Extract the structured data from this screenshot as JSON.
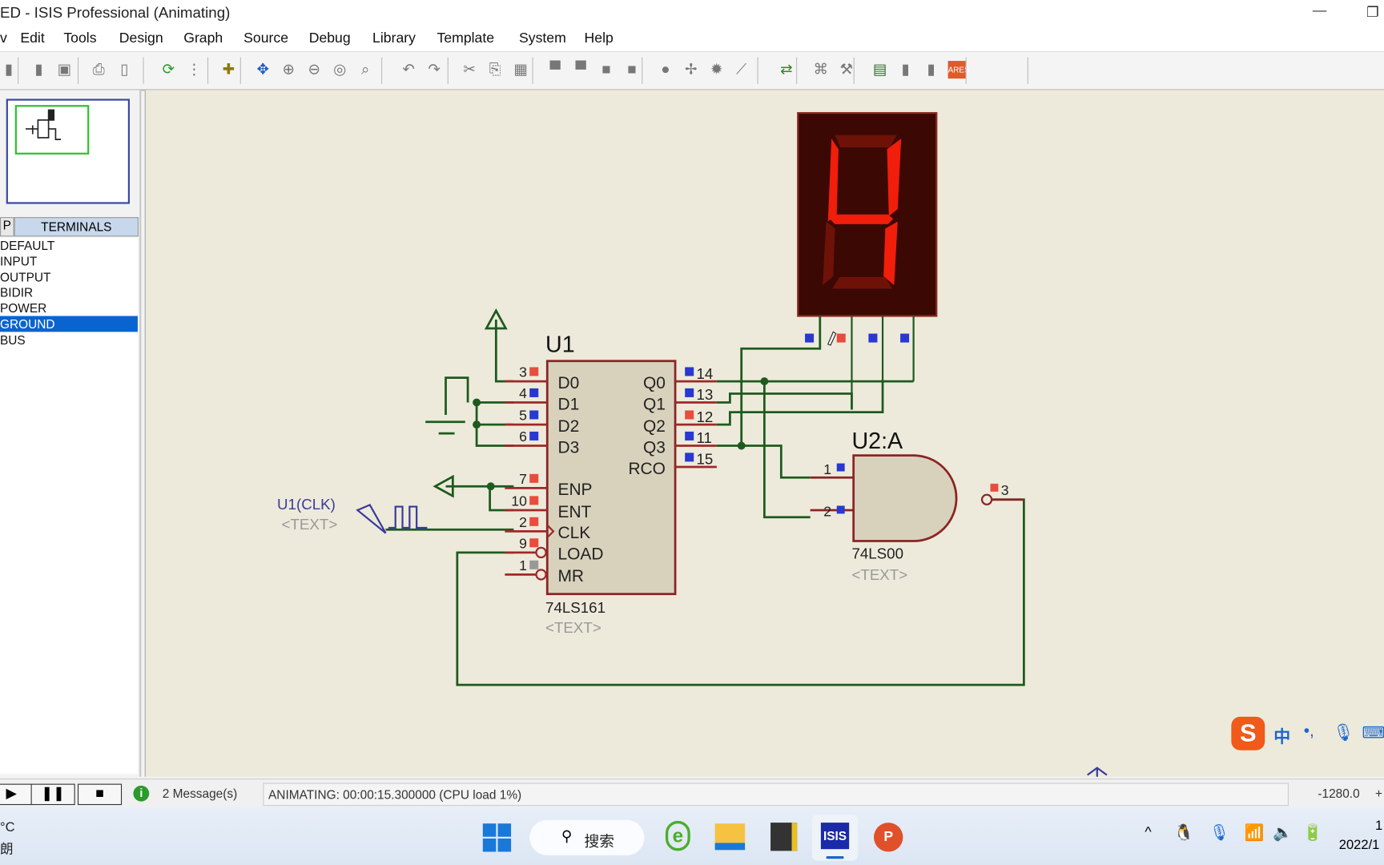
{
  "window": {
    "title": "ED - ISIS Professional (Animating)"
  },
  "menu": [
    "v",
    "Edit",
    "Tools",
    "Design",
    "Graph",
    "Source",
    "Debug",
    "Library",
    "Template",
    "System",
    "Help"
  ],
  "toolbar": {
    "icons": [
      "new-icon",
      "copy-sheet-icon",
      "import-icon",
      "print-icon",
      "page-icon",
      "refresh-icon",
      "grid-icon",
      "origin-icon",
      "pan-icon",
      "zoom-in-icon",
      "zoom-out-icon",
      "zoom-all-icon",
      "zoom-area-icon",
      "undo-icon",
      "redo-icon",
      "cut-icon",
      "copy-icon",
      "paste-icon",
      "block-copy-icon",
      "block-move-icon",
      "block-rotate-icon",
      "block-delete-icon",
      "pick-device-icon",
      "make-device-icon",
      "package-icon",
      "decompose-icon",
      "wire-autorouter-icon",
      "search-icon",
      "property-tool-icon",
      "netlist-icon",
      "bom-icon",
      "electrical-check-icon",
      "ares-icon"
    ],
    "ares_label": "ARES"
  },
  "sidebar": {
    "tab_p": "P",
    "tab_label": "TERMINALS",
    "items": [
      "DEFAULT",
      "INPUT",
      "OUTPUT",
      "BIDIR",
      "POWER",
      "GROUND",
      "BUS"
    ],
    "selected": "GROUND"
  },
  "schematic": {
    "u1": {
      "ref": "U1",
      "part": "74LS161",
      "text": "<TEXT>",
      "left_pins": [
        {
          "num": "3",
          "name": "D0",
          "state": "high"
        },
        {
          "num": "4",
          "name": "D1",
          "state": "low"
        },
        {
          "num": "5",
          "name": "D2",
          "state": "low"
        },
        {
          "num": "6",
          "name": "D3",
          "state": "low"
        },
        {
          "num": "7",
          "name": "ENP",
          "state": "high"
        },
        {
          "num": "10",
          "name": "ENT",
          "state": "high"
        },
        {
          "num": "2",
          "name": "CLK",
          "state": "high"
        },
        {
          "num": "9",
          "name": "LOAD",
          "state": "high"
        },
        {
          "num": "1",
          "name": "MR",
          "state": "float"
        }
      ],
      "right_pins": [
        {
          "num": "14",
          "name": "Q0",
          "state": "low"
        },
        {
          "num": "13",
          "name": "Q1",
          "state": "low"
        },
        {
          "num": "12",
          "name": "Q2",
          "state": "high"
        },
        {
          "num": "11",
          "name": "Q3",
          "state": "low"
        },
        {
          "num": "15",
          "name": "RCO",
          "state": "low"
        }
      ]
    },
    "u2": {
      "ref": "U2:A",
      "part": "74LS00",
      "text": "<TEXT>",
      "pins": [
        {
          "num": "1",
          "state": "low"
        },
        {
          "num": "2",
          "state": "low"
        },
        {
          "num": "3",
          "state": "high"
        }
      ]
    },
    "clock": {
      "label": "U1(CLK)",
      "text": "<TEXT>"
    },
    "display": {
      "digit": "4",
      "lit_segments": [
        "b",
        "c",
        "f",
        "g"
      ]
    },
    "colors": {
      "wire": "#1e5a1e",
      "pin": "#a02828",
      "high": "#e84c3c",
      "low": "#2838d0",
      "segment_on": "#f01e0a",
      "segment_off": "#6e1208",
      "display_bg": "#3c0804"
    }
  },
  "status": {
    "messages": "2 Message(s)",
    "animating": "ANIMATING: 00:00:15.300000 (CPU load 1%)",
    "coord": "-1280.0",
    "coord2": "+"
  },
  "taskbar": {
    "weather_top": "°C",
    "weather_bottom": "朗",
    "search": "搜索",
    "clock_top": "1",
    "clock_bottom": "2022/1"
  }
}
